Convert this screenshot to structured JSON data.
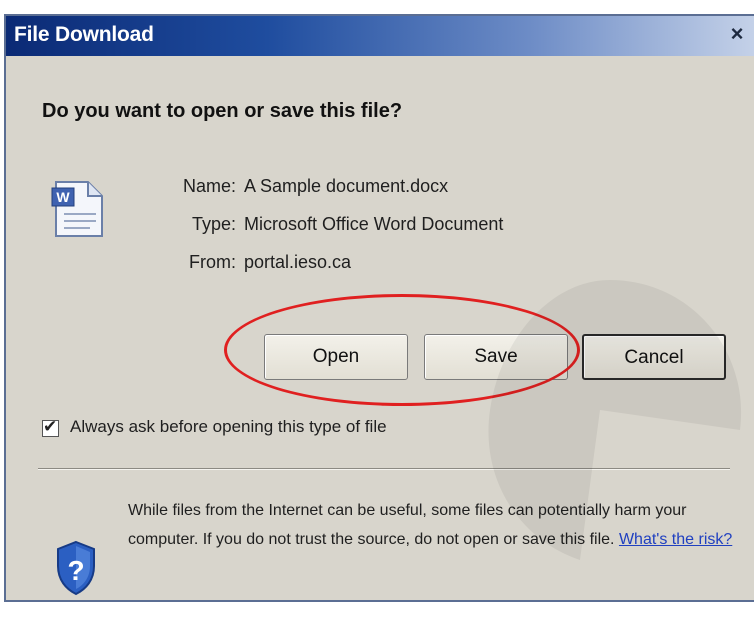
{
  "dialog": {
    "title": "File Download",
    "close_symbol": "×",
    "heading": "Do you want to open or save this file?",
    "file_icon": "word-document-icon",
    "file": {
      "name_label": "Name:",
      "name_value": "A Sample document.docx",
      "type_label": "Type:",
      "type_value": "Microsoft Office Word Document",
      "from_label": "From:",
      "from_value": "portal.ieso.ca"
    },
    "buttons": {
      "open": "Open",
      "save": "Save",
      "cancel": "Cancel"
    },
    "checkbox": {
      "checked": true,
      "mark": "✔",
      "label": "Always ask before opening this type of file"
    },
    "warning": {
      "icon": "shield-question-icon",
      "text": "While files from the Internet can be useful, some files can potentially harm your computer. If you do not trust the source, do not open or save this file.",
      "link": "What's the risk?"
    }
  },
  "colors": {
    "titlebar_start": "#0b2a75",
    "window_bg": "#d8d5cc",
    "highlight_ellipse": "#e02020",
    "link": "#2040c0"
  }
}
